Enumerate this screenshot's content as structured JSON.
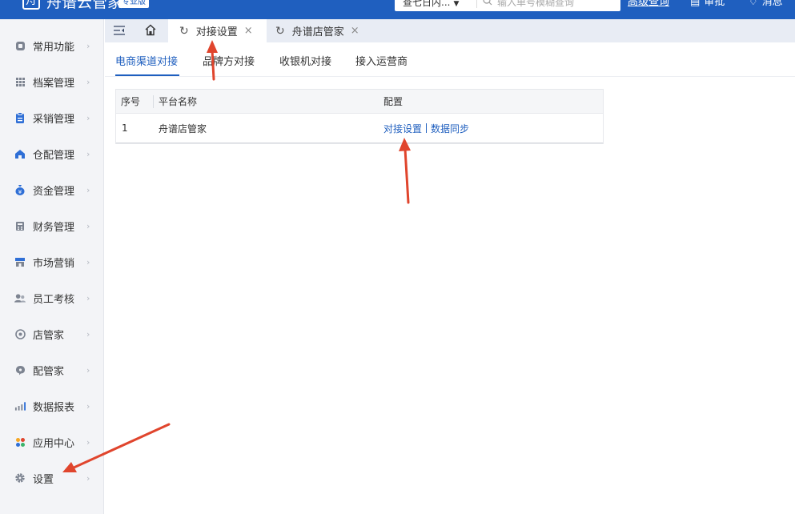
{
  "header": {
    "logo_glyph": "舟",
    "app_name": "舟谱云管家",
    "badge": "专业版",
    "search_select": "查七日内...",
    "search_placeholder": "输入单号模糊查询",
    "advanced_search": "高级查询",
    "approve": "审批",
    "messages": "消息"
  },
  "sidebar": {
    "items": [
      {
        "label": "常用功能",
        "icon": "common-functions-icon"
      },
      {
        "label": "档案管理",
        "icon": "archive-icon"
      },
      {
        "label": "采销管理",
        "icon": "clipboard-icon"
      },
      {
        "label": "仓配管理",
        "icon": "warehouse-icon"
      },
      {
        "label": "资金管理",
        "icon": "money-bag-icon"
      },
      {
        "label": "财务管理",
        "icon": "calculator-icon"
      },
      {
        "label": "市场营销",
        "icon": "store-icon"
      },
      {
        "label": "员工考核",
        "icon": "users-icon"
      },
      {
        "label": "店管家",
        "icon": "shop-keeper-icon"
      },
      {
        "label": "配管家",
        "icon": "chat-bubble-icon"
      },
      {
        "label": "数据报表",
        "icon": "bar-chart-icon"
      },
      {
        "label": "应用中心",
        "icon": "app-grid-icon"
      },
      {
        "label": "设置",
        "icon": "gear-icon"
      }
    ]
  },
  "tabs": [
    {
      "label": "对接设置",
      "active": true
    },
    {
      "label": "舟谱店管家",
      "active": false
    }
  ],
  "subtabs": [
    "电商渠道对接",
    "品牌方对接",
    "收银机对接",
    "接入运营商"
  ],
  "table": {
    "headers": [
      "序号",
      "平台名称",
      "配置"
    ],
    "rows": [
      {
        "index": "1",
        "platform": "舟谱店管家",
        "action1": "对接设置",
        "action2": "数据同步"
      }
    ]
  },
  "colors": {
    "primary": "#1f5fbf",
    "sidebar_bg": "#f3f4f7",
    "annotation": "#e0452d"
  }
}
